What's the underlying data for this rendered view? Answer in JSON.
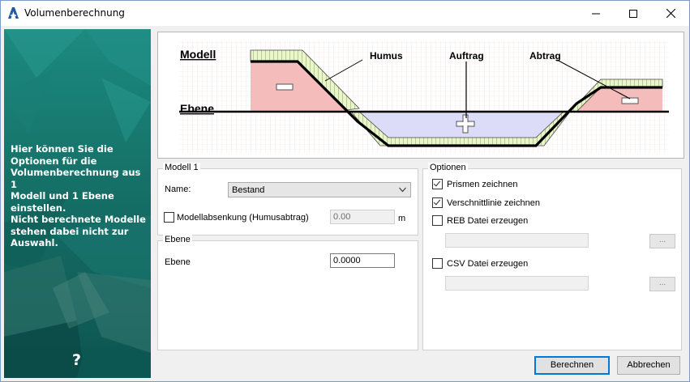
{
  "window": {
    "title": "Volumenberechnung",
    "controls": [
      "minimize",
      "maximize",
      "close"
    ]
  },
  "sidebar": {
    "lines": [
      "Hier können Sie die",
      "Optionen für die",
      "Volumenberechnung aus 1",
      "Modell und 1 Ebene",
      "einstellen.",
      "Nicht berechnete Modelle",
      "stehen dabei nicht zur",
      "Auswahl."
    ],
    "help_label": "?"
  },
  "diagram": {
    "labels": {
      "modell": "Modell",
      "ebene": "Ebene",
      "humus": "Humus",
      "auftrag": "Auftrag",
      "abtrag": "Abtrag"
    },
    "colors": {
      "abtrag_fill": "#f4b8b8",
      "auftrag_fill": "#dcdcf8",
      "humus_fill": "#e8f5c8",
      "grid": "#f4dede"
    }
  },
  "modell_group": {
    "title": "Modell 1",
    "name_label": "Name:",
    "name_value": "Bestand",
    "absenkung_label": "Modellabsenkung (Humusabtrag)",
    "absenkung_checked": false,
    "absenkung_value": "0.00",
    "unit": "m"
  },
  "ebene_group": {
    "title": "Ebene",
    "label": "Ebene",
    "value": "0.0000"
  },
  "optionen_group": {
    "title": "Optionen",
    "prismen_label": "Prismen zeichnen",
    "prismen_checked": true,
    "verschnitt_label": "Verschnittlinie zeichnen",
    "verschnitt_checked": true,
    "reb_label": "REB Datei erzeugen",
    "reb_checked": false,
    "reb_browse": "...",
    "csv_label": "CSV Datei erzeugen",
    "csv_checked": false,
    "csv_browse": "..."
  },
  "buttons": {
    "berechnen": "Berechnen",
    "abbrechen": "Abbrechen"
  },
  "colors": {
    "sidebar_bg": "#177a72",
    "accent": "#0078d7"
  }
}
